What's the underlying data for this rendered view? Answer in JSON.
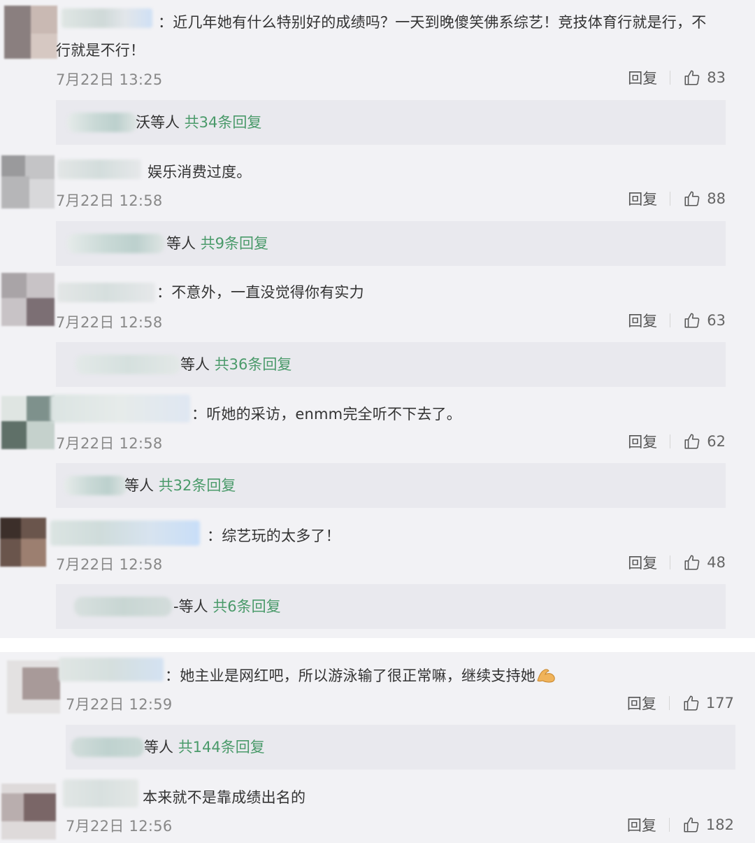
{
  "reply_label": "回复",
  "comments": [
    {
      "text": "：近几年她有什么特别好的成绩吗？一天到晚傻笑佛系综艺！竞技体育行就是行，不行就是不行！",
      "time": "7月22日 13:25",
      "likes": "83",
      "sub_prefix": "沃",
      "sub_mid": "等人",
      "sub_count": "共34条回复"
    },
    {
      "text": "娱乐消费过度。",
      "time": "7月22日 12:58",
      "likes": "88",
      "sub_prefix": "",
      "sub_mid": "等人",
      "sub_count": "共9条回复"
    },
    {
      "text": "：不意外，一直没觉得你有实力",
      "time": "7月22日 12:58",
      "likes": "63",
      "sub_prefix": "",
      "sub_mid": "等人",
      "sub_count": "共36条回复"
    },
    {
      "text": "：听她的采访，enmm完全听不下去了。",
      "time": "7月22日 12:58",
      "likes": "62",
      "sub_prefix": "",
      "sub_mid": "等人",
      "sub_count": "共32条回复"
    },
    {
      "text": "：综艺玩的太多了！",
      "time": "7月22日 12:58",
      "likes": "48",
      "sub_prefix": "-",
      "sub_mid": "等人",
      "sub_count": "共6条回复"
    },
    {
      "text": "：她主业是网红吧，所以游泳输了很正常嘛，继续支持她",
      "emoji": "flexed-biceps",
      "time": "7月22日 12:59",
      "likes": "177",
      "sub_prefix": "",
      "sub_mid": "等人",
      "sub_count": "共144条回复"
    },
    {
      "text": "本来就不是靠成绩出名的",
      "time": "7月22日 12:56",
      "likes": "182"
    }
  ],
  "colors": {
    "background": "#f2f2f5",
    "reply_count": "#4a9a6a",
    "time": "#888888",
    "subbox": "#e9e9ee"
  }
}
